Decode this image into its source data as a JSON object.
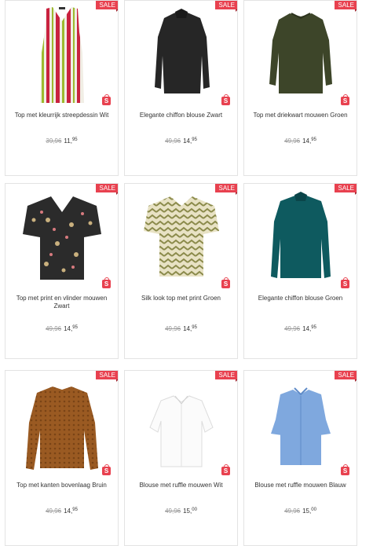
{
  "badge_label": "SALE",
  "shop_icon_glyph": "S",
  "accent_color": "#e8414f",
  "products": [
    {
      "title": "Top met kleurrijk streepdessin Wit",
      "old_price": "39,96",
      "price_int": "11,",
      "price_dec": "95",
      "image": "striped-sleeveless-top"
    },
    {
      "title": "Elegante chiffon blouse Zwart",
      "old_price": "49,96",
      "price_int": "14,",
      "price_dec": "95",
      "image": "black-blouse"
    },
    {
      "title": "Top met driekwart mouwen Groen",
      "old_price": "49,96",
      "price_int": "14,",
      "price_dec": "95",
      "image": "green-blouse"
    },
    {
      "title": "Top met print en vlinder mouwen Zwart",
      "old_price": "49,96",
      "price_int": "14,",
      "price_dec": "95",
      "image": "black-floral-top"
    },
    {
      "title": "Silk look top met print Groen",
      "old_price": "49,96",
      "price_int": "14,",
      "price_dec": "95",
      "image": "zigzag-top"
    },
    {
      "title": "Elegante chiffon blouse Groen",
      "old_price": "49,96",
      "price_int": "14,",
      "price_dec": "95",
      "image": "teal-blouse"
    },
    {
      "title": "Top met kanten bovenlaag Bruin",
      "old_price": "49,96",
      "price_int": "14,",
      "price_dec": "95",
      "image": "brown-lace-top"
    },
    {
      "title": "Blouse met ruffle mouwen Wit",
      "old_price": "49,96",
      "price_int": "15,",
      "price_dec": "00",
      "image": "white-ruffle-blouse"
    },
    {
      "title": "Blouse met ruffle mouwen Blauw",
      "old_price": "49,96",
      "price_int": "15,",
      "price_dec": "00",
      "image": "blue-ruffle-blouse"
    }
  ]
}
